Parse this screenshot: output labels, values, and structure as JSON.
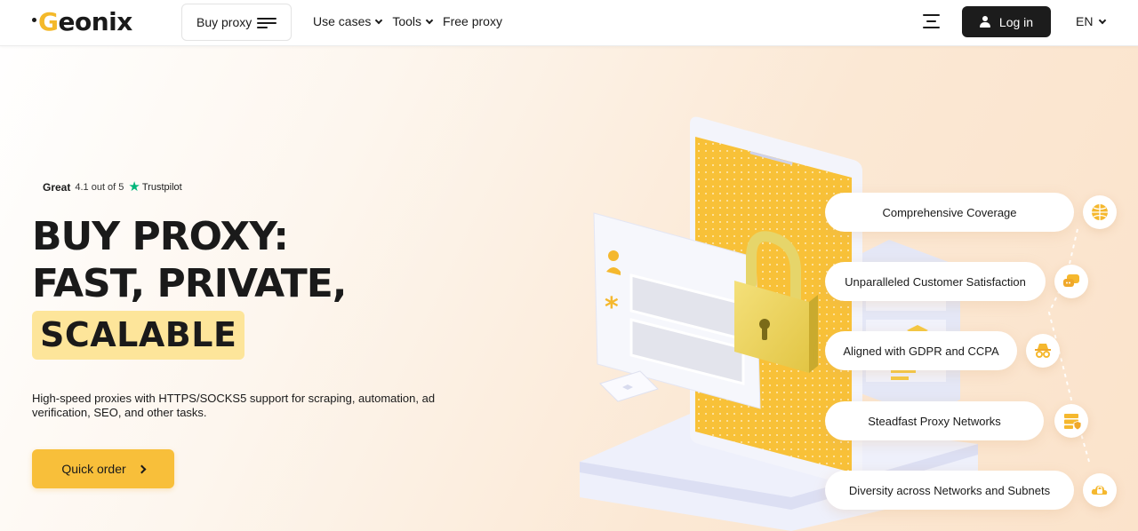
{
  "header": {
    "logo": {
      "dot": "•",
      "g_letter": "G",
      "rest": "eonix"
    },
    "buy_proxy": "Buy proxy",
    "nav": [
      {
        "label": "Use cases",
        "dropdown": true
      },
      {
        "label": "Tools",
        "dropdown": true
      },
      {
        "label": "Free proxy",
        "dropdown": false
      }
    ],
    "login": "Log in",
    "language": "EN"
  },
  "hero": {
    "trust": {
      "rating": "Great",
      "score": "4.1 out of 5",
      "brand": "Trustpilot"
    },
    "headline": {
      "line1": "BUY PROXY:",
      "line2": "FAST, PRIVATE,",
      "highlight": "SCALABLE"
    },
    "subtitle": "High-speed proxies with HTTPS/SOCKS5 support for scraping, automation, ad verification, SEO, and other tasks.",
    "cta": "Quick order"
  },
  "features": [
    {
      "label": "Comprehensive Coverage",
      "icon": "globe-icon"
    },
    {
      "label": "Unparalleled Customer Satisfaction",
      "icon": "chat-icon"
    },
    {
      "label": "Aligned with GDPR and CCPA",
      "icon": "incognito-icon"
    },
    {
      "label": "Steadfast Proxy Networks",
      "icon": "server-shield-icon"
    },
    {
      "label": "Diversity across Networks and Subnets",
      "icon": "cloud-lock-icon"
    }
  ],
  "colors": {
    "accent": "#f8bf3a",
    "highlight": "#fde59a",
    "dark": "#1c1c1c",
    "trustpilot": "#00b67a"
  }
}
